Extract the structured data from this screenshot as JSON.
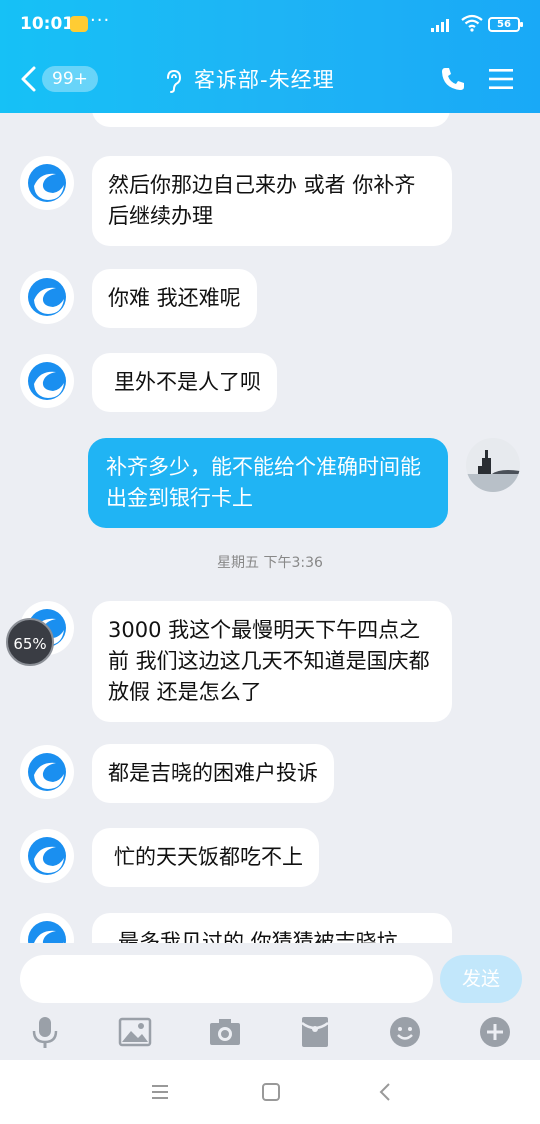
{
  "status_bar": {
    "time": "10:01",
    "dots": "···",
    "battery": "56"
  },
  "header": {
    "unread_count": "99+",
    "title": "客诉部-朱经理"
  },
  "messages": [
    {
      "text": "然后你那边自己来办 或者 你补齐后继续办理"
    },
    {
      "text": "你难 我还难呢"
    },
    {
      "text": "里外不是人了呗"
    },
    {
      "text": "补齐多少，能不能给个准确时间能出金到银行卡上"
    },
    {
      "text": "3000 我这个最慢明天下午四点之前 我们这边这几天不知道是国庆都放假 还是怎么了"
    },
    {
      "text": "都是吉晓的困难户投诉"
    },
    {
      "text": "忙的天天饭都吃不上"
    },
    {
      "text": "最多我见过的 你猜猜被吉晓坑"
    }
  ],
  "time_separator": "星期五 下午3:36",
  "progress_badge": "65%",
  "input": {
    "placeholder": "",
    "send_label": "发送"
  },
  "colors": {
    "header": "#1eb4f5",
    "my_bubble": "#20b4f4",
    "background": "#eceef3"
  }
}
